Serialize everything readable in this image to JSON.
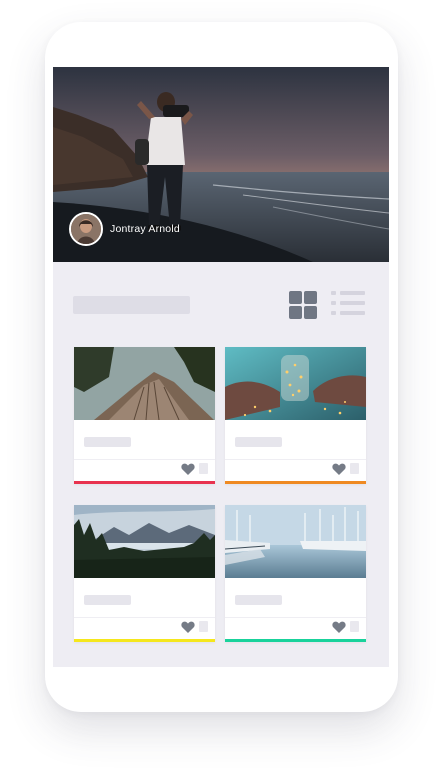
{
  "profile": {
    "name": "Jontray Arnold"
  },
  "view_toggle": {
    "grid_icon": "grid-icon",
    "list_icon": "list-icon"
  },
  "cards": [
    {
      "image": "tree-trunk-photo",
      "accent": "#e8334f"
    },
    {
      "image": "jar-lights-photo",
      "accent": "#ef8a22"
    },
    {
      "image": "mountain-lake-photo",
      "accent": "#f5e71c"
    },
    {
      "image": "marina-boats-photo",
      "accent": "#19d29b"
    }
  ],
  "icons": {
    "favorite": "heart-icon",
    "select": "checkbox-icon"
  }
}
